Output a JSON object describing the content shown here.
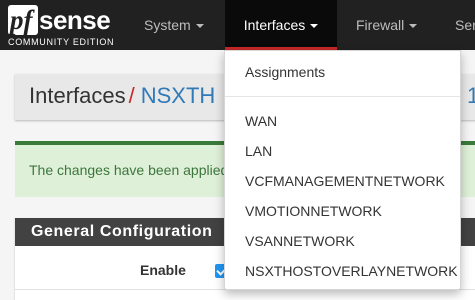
{
  "logo": {
    "pf": "pf",
    "sense": "sense",
    "edition": "COMMUNITY EDITION"
  },
  "nav": {
    "system": "System",
    "interfaces": "Interfaces",
    "firewall": "Firewall",
    "services": "Ser"
  },
  "breadcrumb": {
    "root": "Interfaces",
    "separator": "/",
    "current": "NSXTH",
    "tail": "1"
  },
  "alert": {
    "text": "The changes have been applied"
  },
  "panel": {
    "title": "General Configuration",
    "enable_label": "Enable",
    "enable_checked": true
  },
  "dropdown": {
    "items": [
      "Assignments",
      "WAN",
      "LAN",
      "VCFMANAGEMENTNETWORK",
      "VMOTIONNETWORK",
      "VSANNETWORK",
      "NSXTHOSTOVERLAYNETWORK"
    ]
  },
  "colors": {
    "navbar": "#212121",
    "accent_red": "#c62828",
    "link_blue": "#2f7ab8",
    "success_bg": "#dff0d8",
    "success_text": "#3c763d"
  }
}
